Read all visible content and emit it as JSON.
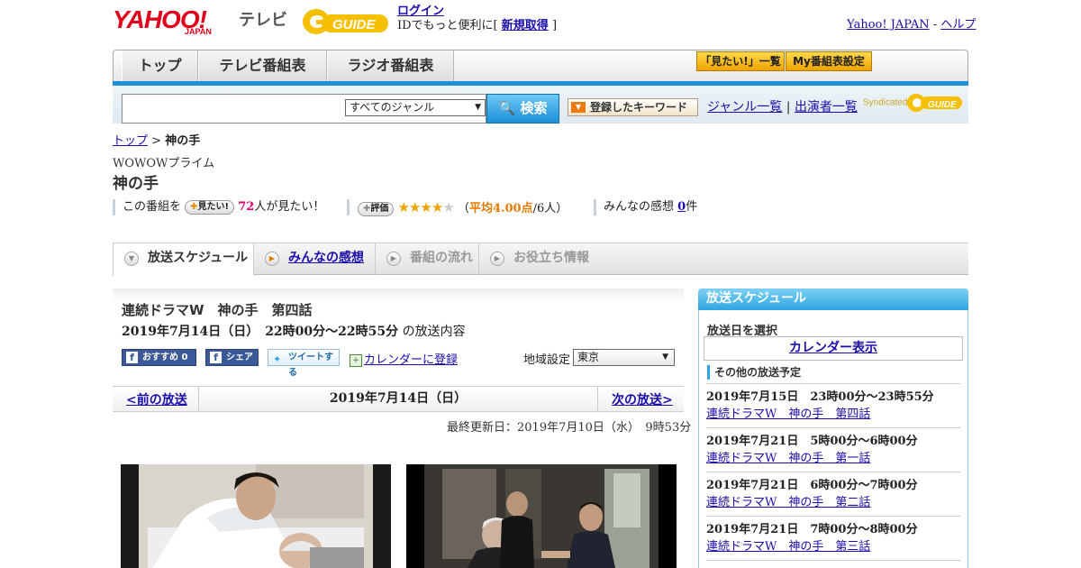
{
  "header": {
    "yahoo": "YAHOO!",
    "japan": "JAPAN",
    "tv": "テレビ",
    "guide_logo": "GUIDE",
    "login": "ログイン",
    "login_prompt": "IDでもっと便利に[",
    "signup": "新規取得",
    "login_close": "]",
    "yahoo_japan_link": "Yahoo! JAPAN",
    "sep": "-",
    "help_link": "ヘルプ"
  },
  "nav": {
    "tabs": [
      "トップ",
      "テレビ番組表",
      "ラジオ番組表"
    ],
    "want_list": "「見たい!」一覧",
    "my_listings": "My番組表設定"
  },
  "search": {
    "placeholder": "",
    "genre": "すべてのジャンル",
    "button": "検索",
    "registered_keywords": "登録したキーワード",
    "genre_list": "ジャンル一覧",
    "divider": "|",
    "performer_list": "出演者一覧",
    "syndicated": "Syndicated"
  },
  "breadcrumb": {
    "top": "トップ",
    "sep": ">",
    "current": "神の手"
  },
  "program": {
    "channel": "WOWOWプライム",
    "title": "神の手",
    "want_prefix": "この番組を",
    "want_button": "見たい!",
    "want_count": "72",
    "want_suffix": "人が見たい！",
    "rate_button": "評価",
    "stars_on": "★★★★",
    "stars_off": "★",
    "avg_open": "（",
    "avg_text": "平均4.00点",
    "avg_count": "/6人）",
    "comments_label": "みんなの感想",
    "comments_count": "0",
    "comments_unit": "件"
  },
  "tabs": [
    {
      "label": "放送スケジュール",
      "state": "active"
    },
    {
      "label": "みんなの感想",
      "state": "link"
    },
    {
      "label": "番組の流れ",
      "state": "disabled"
    },
    {
      "label": "お役立ち情報",
      "state": "disabled"
    }
  ],
  "episode": {
    "title": "連続ドラマW　神の手　第四話",
    "datetime": "2019年7月14日（日）　22時00分～22時55分",
    "datetime_suffix": "の放送内容",
    "fb_recommend": "おすすめ 0",
    "fb_share": "シェア",
    "tweet": "ツイートする",
    "calendar": "カレンダーに登録",
    "region_label": "地域設定",
    "region": "東京",
    "prev": "<前の放送",
    "current_date": "2019年7月14日（日）",
    "next": "次の放送>",
    "updated": "最終更新日：2019年7月10日（水）　9時53分"
  },
  "sidebar": {
    "title": "放送スケジュール",
    "select_date": "放送日を選択",
    "calendar": "カレンダー表示",
    "other": "その他の放送予定",
    "schedule": [
      {
        "date": "2019年7月15日　23時00分～23時55分",
        "title": "連続ドラマW　神の手　第四話"
      },
      {
        "date": "2019年7月21日　5時00分～6時00分",
        "title": "連続ドラマW　神の手　第一話"
      },
      {
        "date": "2019年7月21日　6時00分～7時00分",
        "title": "連続ドラマW　神の手　第二話"
      },
      {
        "date": "2019年7月21日　7時00分～8時00分",
        "title": "連続ドラマW　神の手　第三話"
      }
    ]
  },
  "colors": {
    "accent": "#1b8fd7",
    "yahoo_red": "#e0001a",
    "guide_yellow": "#f5c000",
    "link": "#1a0dab"
  }
}
